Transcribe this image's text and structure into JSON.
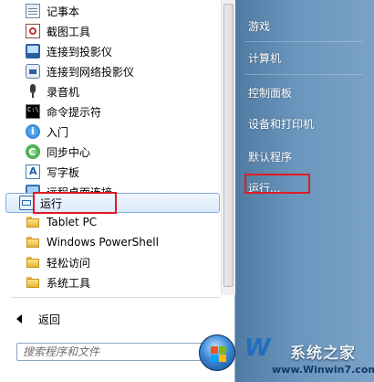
{
  "programs": [
    {
      "label": "记事本",
      "icon": "notepad-icon"
    },
    {
      "label": "截图工具",
      "icon": "snipping-tool-icon"
    },
    {
      "label": "连接到投影仪",
      "icon": "projector-icon"
    },
    {
      "label": "连接到网络投影仪",
      "icon": "network-projector-icon"
    },
    {
      "label": "录音机",
      "icon": "microphone-icon"
    },
    {
      "label": "命令提示符",
      "icon": "command-prompt-icon"
    },
    {
      "label": "入门",
      "icon": "getting-started-icon"
    },
    {
      "label": "同步中心",
      "icon": "sync-center-icon"
    },
    {
      "label": "写字板",
      "icon": "wordpad-icon"
    },
    {
      "label": "远程桌面连接",
      "icon": "remote-desktop-icon"
    },
    {
      "label": "运行",
      "icon": "run-icon"
    },
    {
      "label": "Tablet PC",
      "icon": "folder-icon"
    },
    {
      "label": "Windows PowerShell",
      "icon": "folder-icon"
    },
    {
      "label": "轻松访问",
      "icon": "folder-icon"
    },
    {
      "label": "系统工具",
      "icon": "folder-icon"
    }
  ],
  "back_label": "返回",
  "search": {
    "placeholder": "搜索程序和文件"
  },
  "right_links": [
    {
      "label": "游戏"
    },
    {
      "label": "计算机"
    },
    {
      "label": "控制面板"
    },
    {
      "label": "设备和打印机"
    },
    {
      "label": "默认程序"
    },
    {
      "label": "运行..."
    }
  ],
  "watermark": {
    "logo": "W",
    "name": "系统之家",
    "url": "www.Winwin7.com"
  },
  "colors": {
    "highlight": "#e11b22",
    "selection_border": "#84acdd",
    "right_pane": "#6b96bd"
  }
}
